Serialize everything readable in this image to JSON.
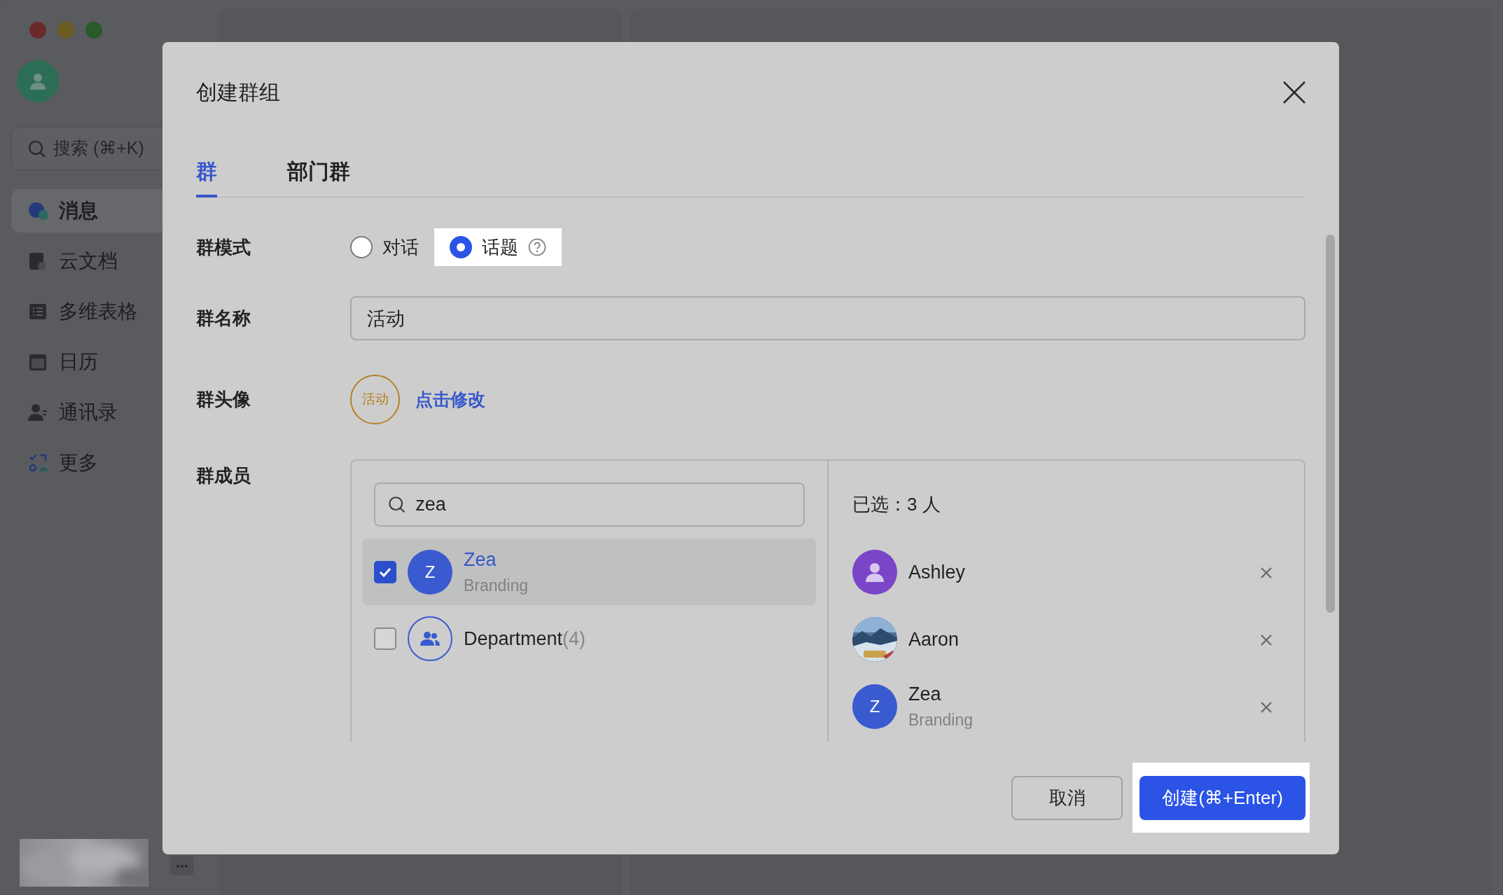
{
  "app": {
    "sidebar": {
      "search": {
        "placeholder": "搜索 (⌘+K)"
      },
      "items": [
        {
          "label": "消息",
          "selected": true
        },
        {
          "label": "云文档",
          "selected": false
        },
        {
          "label": "多维表格",
          "selected": false
        },
        {
          "label": "日历",
          "selected": false
        },
        {
          "label": "通讯录",
          "selected": false
        },
        {
          "label": "更多",
          "selected": false
        }
      ]
    }
  },
  "dialog": {
    "title": "创建群组",
    "tabs": [
      {
        "label": "群",
        "selected": true
      },
      {
        "label": "部门群",
        "selected": false
      }
    ],
    "mode": {
      "label": "群模式",
      "options": [
        {
          "label": "对话",
          "selected": false,
          "highlighted": false,
          "help": false
        },
        {
          "label": "话题",
          "selected": true,
          "highlighted": true,
          "help": true
        }
      ]
    },
    "name": {
      "label": "群名称",
      "value": "活动"
    },
    "avatar": {
      "label": "群头像",
      "text": "活动",
      "link": "点击修改"
    },
    "members": {
      "label": "群成员",
      "search": {
        "value": "zea"
      },
      "results": [
        {
          "kind": "person",
          "name": "Zea",
          "letter": "Z",
          "subtitle": "Branding",
          "checked": true,
          "selected": true
        },
        {
          "kind": "group",
          "name": "Department",
          "count": "(4)",
          "checked": false,
          "selected": false
        }
      ],
      "selected_title": "已选：3 人",
      "selected": [
        {
          "kind": "silhouette",
          "name": "Ashley",
          "color": "#7a45c6"
        },
        {
          "kind": "picture",
          "name": "Aaron"
        },
        {
          "kind": "letter",
          "name": "Zea",
          "letter": "Z",
          "subtitle": "Branding",
          "color": "#3a5bcf"
        }
      ]
    },
    "buttons": [
      {
        "kind": "secondary",
        "label": "取消",
        "highlighted": false
      },
      {
        "kind": "primary",
        "label": "创建(⌘+Enter)",
        "highlighted": true
      }
    ]
  }
}
